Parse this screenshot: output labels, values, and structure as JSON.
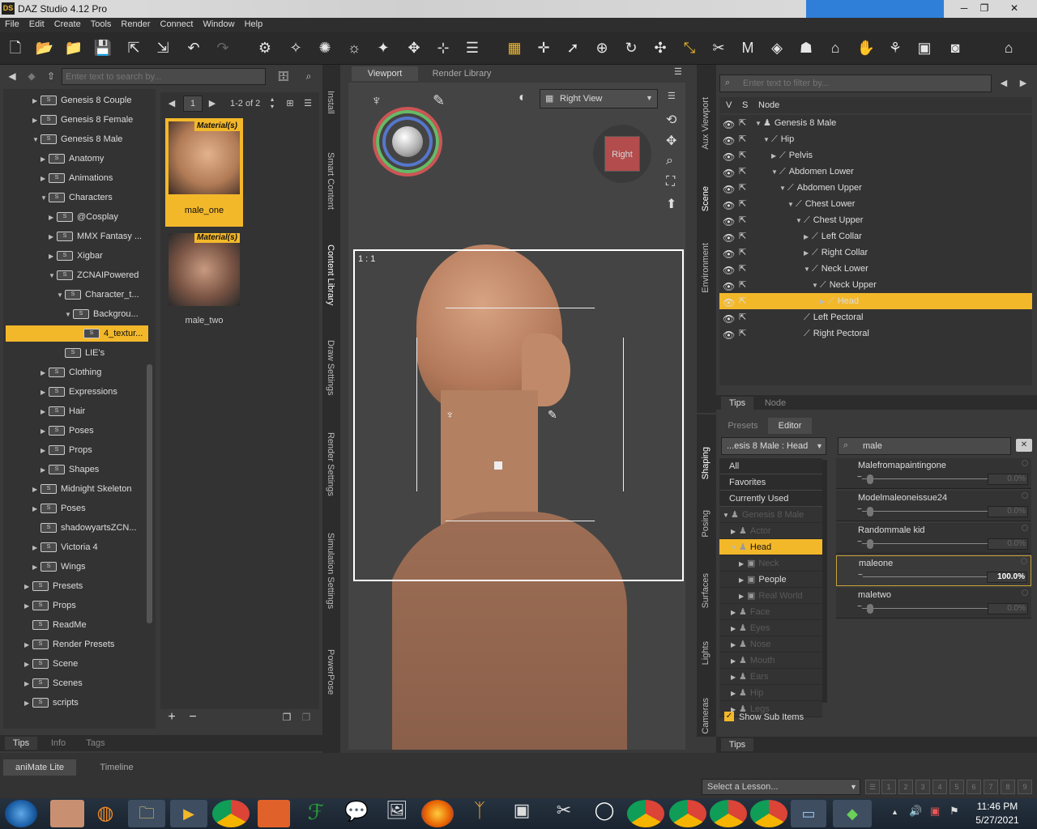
{
  "app": {
    "title": "DAZ Studio 4.12 Pro",
    "logo": "DS"
  },
  "menu": [
    "File",
    "Edit",
    "Create",
    "Tools",
    "Render",
    "Connect",
    "Window",
    "Help"
  ],
  "left": {
    "search_placeholder": "Enter text to search by...",
    "tree": [
      {
        "label": "Genesis 8 Couple",
        "depth": 0,
        "arrow": "▶"
      },
      {
        "label": "Genesis 8 Female",
        "depth": 0,
        "arrow": "▶"
      },
      {
        "label": "Genesis 8 Male",
        "depth": 0,
        "arrow": "▼"
      },
      {
        "label": "Anatomy",
        "depth": 1,
        "arrow": "▶"
      },
      {
        "label": "Animations",
        "depth": 1,
        "arrow": "▶"
      },
      {
        "label": "Characters",
        "depth": 1,
        "arrow": "▼"
      },
      {
        "label": "@Cosplay",
        "depth": 2,
        "arrow": "▶"
      },
      {
        "label": "MMX Fantasy ...",
        "depth": 2,
        "arrow": "▶"
      },
      {
        "label": "Xigbar",
        "depth": 2,
        "arrow": "▶"
      },
      {
        "label": "ZCNAIPowered",
        "depth": 2,
        "arrow": "▼"
      },
      {
        "label": "Character_t...",
        "depth": 3,
        "arrow": "▼"
      },
      {
        "label": "Backgrou...",
        "depth": 4,
        "arrow": "▼"
      },
      {
        "label": "4_textur...",
        "depth": 5,
        "arrow": "",
        "selected": true
      },
      {
        "label": "LIE's",
        "depth": 3,
        "arrow": ""
      },
      {
        "label": "Clothing",
        "depth": 1,
        "arrow": "▶"
      },
      {
        "label": "Expressions",
        "depth": 1,
        "arrow": "▶"
      },
      {
        "label": "Hair",
        "depth": 1,
        "arrow": "▶"
      },
      {
        "label": "Poses",
        "depth": 1,
        "arrow": "▶"
      },
      {
        "label": "Props",
        "depth": 1,
        "arrow": "▶"
      },
      {
        "label": "Shapes",
        "depth": 1,
        "arrow": "▶"
      },
      {
        "label": "Midnight Skeleton",
        "depth": 0,
        "arrow": "▶"
      },
      {
        "label": "Poses",
        "depth": 0,
        "arrow": "▶"
      },
      {
        "label": "shadowyartsZCN...",
        "depth": 0,
        "arrow": ""
      },
      {
        "label": "Victoria 4",
        "depth": 0,
        "arrow": "▶"
      },
      {
        "label": "Wings",
        "depth": 0,
        "arrow": "▶"
      },
      {
        "label": "Presets",
        "depth": -1,
        "arrow": "▶"
      },
      {
        "label": "Props",
        "depth": -1,
        "arrow": "▶"
      },
      {
        "label": "ReadMe",
        "depth": -1,
        "arrow": ""
      },
      {
        "label": "Render Presets",
        "depth": -1,
        "arrow": "▶"
      },
      {
        "label": "Scene",
        "depth": -1,
        "arrow": "▶"
      },
      {
        "label": "Scenes",
        "depth": -1,
        "arrow": "▶"
      },
      {
        "label": "scripts",
        "depth": -1,
        "arrow": "▶"
      }
    ],
    "page_num": "1",
    "page_range": "1-2 of 2",
    "items": [
      {
        "label": "male_one",
        "badge": "Material(s)"
      },
      {
        "label": "male_two",
        "badge": "Material(s)"
      }
    ],
    "bottom_tabs": [
      "Tips",
      "Info",
      "Tags"
    ]
  },
  "side_tabs_left": [
    "Install",
    "Smart Content",
    "Content Library",
    "Draw Settings",
    "Render Settings",
    "Simulation Settings",
    "PowerPose"
  ],
  "viewport": {
    "tabs": [
      "Viewport",
      "Render Library"
    ],
    "view": "Right View",
    "ratio": "1 : 1",
    "cube_label": "Right"
  },
  "side_tabs_right": [
    "Aux Viewport",
    "Scene",
    "Environment"
  ],
  "side_tabs_right2": [
    "Shaping",
    "Posing",
    "Surfaces",
    "Lights",
    "Cameras"
  ],
  "scene": {
    "filter_placeholder": "Enter text to filter by...",
    "headers": [
      "V",
      "S",
      "Node"
    ],
    "nodes": [
      {
        "label": "Genesis 8 Male",
        "depth": 0,
        "arrow": "▼",
        "figure": true
      },
      {
        "label": "Hip",
        "depth": 1,
        "arrow": "▼"
      },
      {
        "label": "Pelvis",
        "depth": 2,
        "arrow": "▶"
      },
      {
        "label": "Abdomen Lower",
        "depth": 2,
        "arrow": "▼"
      },
      {
        "label": "Abdomen Upper",
        "depth": 3,
        "arrow": "▼"
      },
      {
        "label": "Chest Lower",
        "depth": 4,
        "arrow": "▼"
      },
      {
        "label": "Chest Upper",
        "depth": 5,
        "arrow": "▼"
      },
      {
        "label": "Left Collar",
        "depth": 6,
        "arrow": "▶"
      },
      {
        "label": "Right Collar",
        "depth": 6,
        "arrow": "▶"
      },
      {
        "label": "Neck Lower",
        "depth": 6,
        "arrow": "▼"
      },
      {
        "label": "Neck Upper",
        "depth": 7,
        "arrow": "▼"
      },
      {
        "label": "Head",
        "depth": 8,
        "arrow": "▶",
        "selected": true
      },
      {
        "label": "Left Pectoral",
        "depth": 5,
        "arrow": ""
      },
      {
        "label": "Right Pectoral",
        "depth": 5,
        "arrow": ""
      }
    ],
    "tabs": [
      "Tips",
      "Node"
    ]
  },
  "shaping": {
    "tabs": [
      "Presets",
      "Editor"
    ],
    "node_select": "...esis 8 Male : Head",
    "search": "male",
    "groups": [
      {
        "label": "All",
        "kind": "plain"
      },
      {
        "label": "Favorites",
        "kind": "plain"
      },
      {
        "label": "Currently Used",
        "kind": "plain"
      },
      {
        "label": "Genesis 8 Male",
        "kind": "dim",
        "arrow": "▼"
      },
      {
        "label": "Actor",
        "kind": "dim",
        "arrow": "▶"
      },
      {
        "label": "Head",
        "kind": "selected",
        "arrow": "▼"
      },
      {
        "label": "Neck",
        "kind": "dim",
        "arrow": "▶"
      },
      {
        "label": "People",
        "kind": "sub",
        "arrow": "▶"
      },
      {
        "label": "Real World",
        "kind": "dim",
        "arrow": "▶"
      },
      {
        "label": "Face",
        "kind": "dim",
        "arrow": "▶"
      },
      {
        "label": "Eyes",
        "kind": "dim",
        "arrow": "▶"
      },
      {
        "label": "Nose",
        "kind": "dim",
        "arrow": "▶"
      },
      {
        "label": "Mouth",
        "kind": "dim",
        "arrow": "▶"
      },
      {
        "label": "Ears",
        "kind": "dim",
        "arrow": "▶"
      },
      {
        "label": "Hip",
        "kind": "dim",
        "arrow": "▶"
      },
      {
        "label": "Legs",
        "kind": "dim",
        "arrow": "▶"
      }
    ],
    "sliders": [
      {
        "label": "Malefromapaintingone",
        "value": "0.0%",
        "level": 0
      },
      {
        "label": "Modelmaleoneissue24",
        "value": "0.0%",
        "level": 0
      },
      {
        "label": "Randommale kid",
        "value": "0.0%",
        "level": 0
      },
      {
        "label": "maleone",
        "value": "100.0%",
        "level": 1,
        "active": true
      },
      {
        "label": "maletwo",
        "value": "0.0%",
        "level": 0
      }
    ],
    "show_sub": "Show Sub Items",
    "tips": "Tips"
  },
  "bottom": {
    "tabs": [
      "aniMate Lite",
      "Timeline"
    ],
    "lesson": "Select a Lesson...",
    "lesson_pages": [
      "1",
      "2",
      "3",
      "4",
      "5",
      "6",
      "7",
      "8",
      "9"
    ]
  },
  "taskbar": {
    "time": "11:46 PM",
    "date": "5/27/2021"
  }
}
